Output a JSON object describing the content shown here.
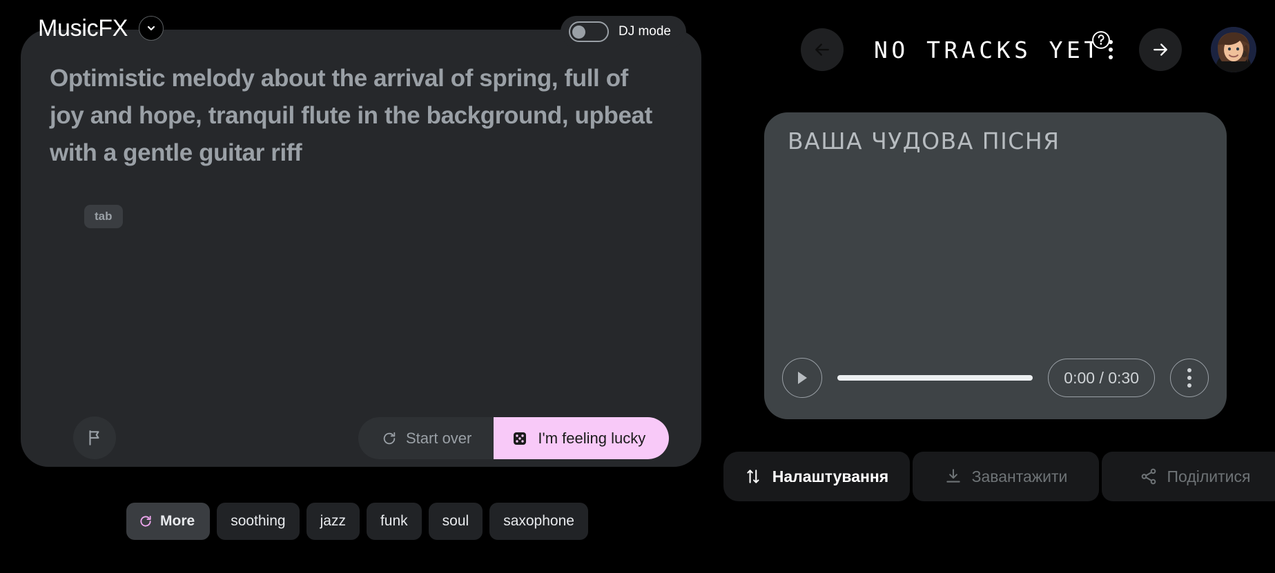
{
  "app": {
    "brand": "MusicFX",
    "brand_caret_icon": "chevron-down-icon",
    "accent_pink": "#f8c9f8",
    "panel_bg": "#26282b",
    "card_bg": "#3e4346",
    "page_bg": "#000000"
  },
  "dj": {
    "label": "DJ mode",
    "enabled": false,
    "toggle_icon": "toggle-off-icon"
  },
  "prompt": {
    "text": "Optimistic melody about the arrival of spring, full of joy and hope, tranquil flute in the background, upbeat with a gentle guitar riff",
    "hint_chip": "tab"
  },
  "left_actions": {
    "flag_icon": "flag-icon",
    "start_over_label": "Start over",
    "start_over_icon": "refresh-icon",
    "lucky_label": "I'm feeling lucky",
    "lucky_icon": "dice-icon"
  },
  "chips": [
    {
      "label": "More",
      "icon": "refresh-icon",
      "active": true
    },
    {
      "label": "soothing",
      "icon": "",
      "active": false
    },
    {
      "label": "jazz",
      "icon": "",
      "active": false
    },
    {
      "label": "funk",
      "icon": "",
      "active": false
    },
    {
      "label": "soul",
      "icon": "",
      "active": false
    },
    {
      "label": "saxophone",
      "icon": "",
      "active": false
    }
  ],
  "topbar": {
    "back_icon": "arrow-left-icon",
    "title": "NO TRACKS YET",
    "help_icon": "help-circle-icon",
    "forward_icon": "arrow-right-icon",
    "menu_icon": "kebab-menu-icon",
    "avatar_icon": "user-avatar"
  },
  "track": {
    "title": "ВАША ЧУДОВА ПІСНЯ",
    "play_icon": "play-icon",
    "progress_percent": 0,
    "time_display": "0:00 / 0:30",
    "menu_icon": "kebab-menu-icon"
  },
  "bottom_actions": [
    {
      "label": "Налаштування",
      "icon": "tune-sliders-icon",
      "state": "active"
    },
    {
      "label": "Завантажити",
      "icon": "download-icon",
      "state": "disabled"
    },
    {
      "label": "Поділитися",
      "icon": "share-icon",
      "state": "disabled"
    }
  ]
}
